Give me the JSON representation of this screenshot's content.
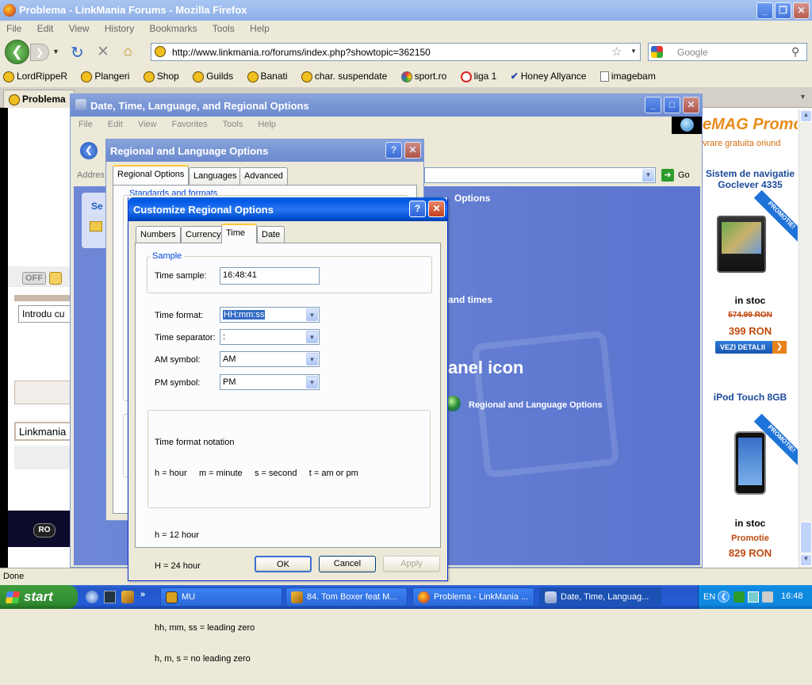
{
  "firefox": {
    "title": "Problema - LinkMania Forums - Mozilla Firefox",
    "menu": [
      "File",
      "Edit",
      "View",
      "History",
      "Bookmarks",
      "Tools",
      "Help"
    ],
    "url": "http://www.linkmania.ro/forums/index.php?showtopic=362150",
    "search_placeholder": "Google",
    "bookmarks": [
      "LordRippeR",
      "Plangeri",
      "Shop",
      "Guilds",
      "Banati",
      "char. suspendate",
      "sport.ro",
      "liga 1",
      "Honey Allyance",
      "imagebam"
    ],
    "tab_label": "Problema",
    "status": "Done"
  },
  "page": {
    "off_label": "OFF",
    "input_text": "Introdu cu",
    "linkmania_text": "Linkmania",
    "ro_label": "RO"
  },
  "ad": {
    "brand": "eMAG Promo",
    "delivery": "vrare gratuita oriund",
    "product1_title": "Sistem de navigatie Goclever 4335",
    "badge": "PROMOTIE!",
    "product1_stock": "in stoc",
    "product1_old_price": "574.99 RON",
    "product1_price": "399 RON",
    "details_button": "VEZI DETALII",
    "product2_title": "iPod Touch 8GB",
    "product2_stock": "in stoc",
    "product2_promo": "Promotie",
    "product2_price": "829 RON"
  },
  "cp": {
    "title": "Date, Time, Language, and Regional Options",
    "menu": [
      "File",
      "Edit",
      "View",
      "Favorites",
      "Tools",
      "Help"
    ],
    "address_label": "Addres",
    "go_label": "Go",
    "panel_label_frag": "Se",
    "text_options": "Options",
    "text_and_times": "and times",
    "text_panel_icon": "anel icon",
    "link_regional": "Regional and Language Options"
  },
  "rlo": {
    "title": "Regional and Language Options",
    "tabs": [
      "Regional Options",
      "Languages",
      "Advanced"
    ],
    "group_label": "Standards and formats"
  },
  "cro": {
    "title": "Customize Regional Options",
    "tabs": [
      "Numbers",
      "Currency",
      "Time",
      "Date"
    ],
    "sample_group": "Sample",
    "time_sample_label": "Time sample:",
    "time_sample_value": "16:48:41",
    "format_label": "Time format:",
    "format_value": "HH:mm:ss",
    "separator_label": "Time separator:",
    "separator_value": ":",
    "am_label": "AM symbol:",
    "am_value": "AM",
    "pm_label": "PM symbol:",
    "pm_value": "PM",
    "notation_title": "Time format notation",
    "notation_line1": "h = hour     m = minute     s = second     t = am or pm",
    "notation_line2": "h = 12 hour",
    "notation_line3": "H = 24 hour",
    "notation_line4": "hh, mm, ss = leading zero",
    "notation_line5": "h, m, s = no leading zero",
    "ok": "OK",
    "cancel": "Cancel",
    "apply": "Apply"
  },
  "taskbar": {
    "start": "start",
    "items": [
      "MU",
      "84. Tom Boxer feat M...",
      "Problema - LinkMania ...",
      "Date, Time, Languag..."
    ],
    "lang": "EN",
    "clock": "16:48"
  }
}
